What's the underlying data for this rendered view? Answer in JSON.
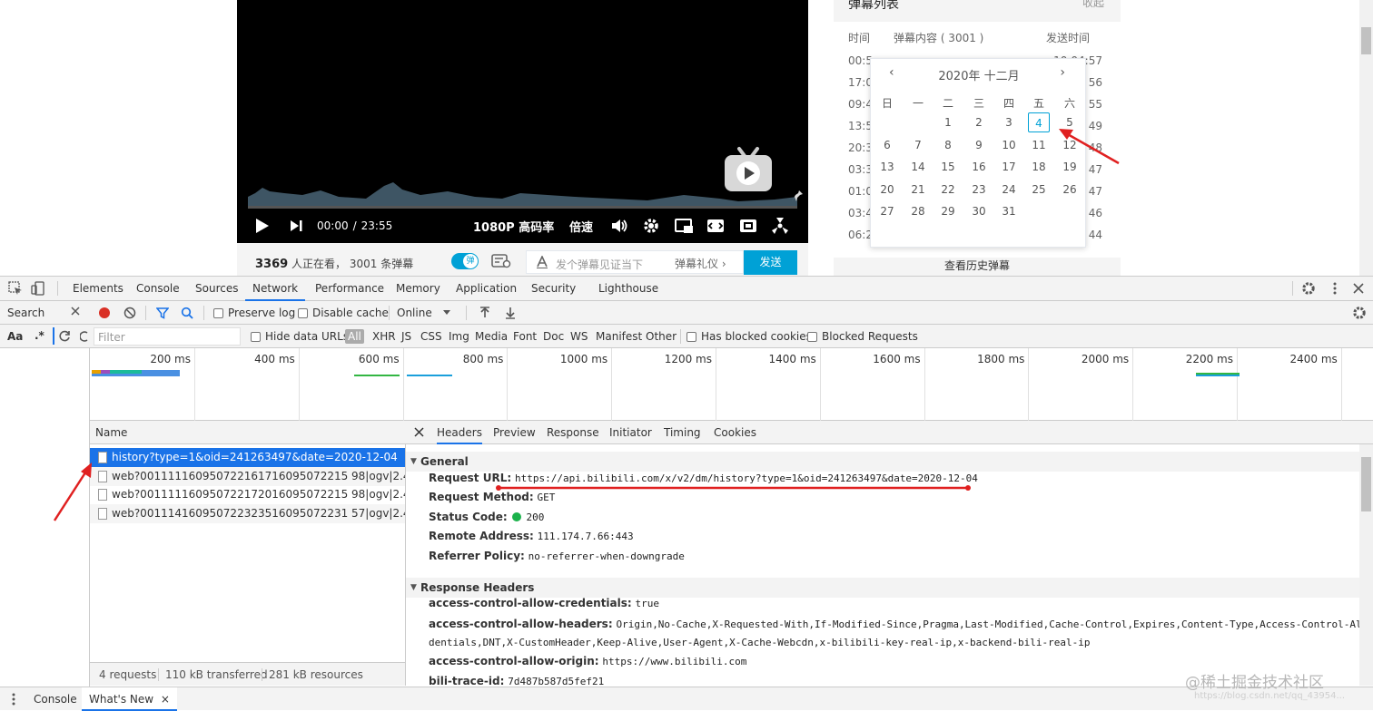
{
  "player": {
    "current_time": "00:00",
    "time_sep": "/",
    "duration": "23:55",
    "quality": "1080P 高码率",
    "speed": "倍速",
    "viewers_count": "3369",
    "viewers_text": "人正在看，",
    "danmaku_count_text": "3001 条弹幕",
    "danmaku_toggle": "弹",
    "danmaku_placeholder": "发个弹幕见证当下",
    "danmaku_etiquette": "弹幕礼仪 ›",
    "send_label": "发送"
  },
  "danmaku_panel": {
    "title": "弹幕列表",
    "collapse": "收起",
    "col_time": "时间",
    "col_content": "弹幕内容 ( 3001 )",
    "col_send_time": "发送时间",
    "row_times": [
      "00:5",
      "17:0",
      "09:4",
      "13:5",
      "20:3",
      "03:3",
      "01:0",
      "03:4",
      "06:2"
    ],
    "row_send_times": [
      "10:04:57",
      "56",
      "55",
      "49",
      "48",
      "47",
      "47",
      "46",
      "44"
    ],
    "history_button": "查看历史弹幕"
  },
  "calendar": {
    "header": "2020年 十二月",
    "prev": "‹",
    "next": "›",
    "weekdays": [
      "日",
      "一",
      "二",
      "三",
      "四",
      "五",
      "六"
    ],
    "weeks": [
      [
        "",
        "",
        "1",
        "2",
        "3",
        "4",
        "5"
      ],
      [
        "6",
        "7",
        "8",
        "9",
        "10",
        "11",
        "12"
      ],
      [
        "13",
        "14",
        "15",
        "16",
        "17",
        "18",
        "19"
      ],
      [
        "20",
        "21",
        "22",
        "23",
        "24",
        "25",
        "26"
      ],
      [
        "27",
        "28",
        "29",
        "30",
        "31",
        "",
        ""
      ]
    ],
    "selected": "4"
  },
  "devtools": {
    "tabs": [
      "Elements",
      "Console",
      "Sources",
      "Network",
      "Performance",
      "Memory",
      "Application",
      "Security",
      "Lighthouse"
    ],
    "active_tab": "Network",
    "search_label": "Search",
    "aa": "Aa",
    "regex": ".*",
    "toolbar": {
      "preserve_log": "Preserve log",
      "disable_cache": "Disable cache",
      "throttle": "Online"
    },
    "filter": {
      "placeholder": "Filter",
      "hide_data_urls": "Hide data URLs",
      "types": [
        "All",
        "XHR",
        "JS",
        "CSS",
        "Img",
        "Media",
        "Font",
        "Doc",
        "WS",
        "Manifest",
        "Other"
      ],
      "has_blocked_cookies": "Has blocked cookies",
      "blocked_requests": "Blocked Requests"
    },
    "timeline_ticks": [
      "200 ms",
      "400 ms",
      "600 ms",
      "800 ms",
      "1000 ms",
      "1200 ms",
      "1400 ms",
      "1600 ms",
      "1800 ms",
      "2000 ms",
      "2200 ms",
      "2400 ms"
    ],
    "list_header": "Name",
    "requests": [
      "history?type=1&oid=241263497&date=2020-12-04",
      "web?001111160950722161716095072215 98|ogv|2.48.8-82...",
      "web?001111160950722172016095072215 98|ogv|2.48.8-82...",
      "web?001114160950722323516095072231 57|ogv|2.48.8-82..."
    ],
    "status": {
      "requests": "4 requests",
      "transferred": "110 kB transferred",
      "resources": "281 kB resources"
    },
    "detail_tabs": [
      "Headers",
      "Preview",
      "Response",
      "Initiator",
      "Timing",
      "Cookies"
    ],
    "general_title": "General",
    "general": [
      {
        "k": "Request URL:",
        "v": "https://api.bilibili.com/x/v2/dm/history?type=1&oid=241263497&date=2020-12-04"
      },
      {
        "k": "Request Method:",
        "v": "GET"
      },
      {
        "k": "Status Code:",
        "v": "200"
      },
      {
        "k": "Remote Address:",
        "v": "111.174.7.66:443"
      },
      {
        "k": "Referrer Policy:",
        "v": "no-referrer-when-downgrade"
      }
    ],
    "response_title": "Response Headers",
    "response_headers": [
      {
        "k": "access-control-allow-credentials:",
        "v": "true"
      },
      {
        "k": "access-control-allow-headers:",
        "v": "Origin,No-Cache,X-Requested-With,If-Modified-Since,Pragma,Last-Modified,Cache-Control,Expires,Content-Type,Access-Control-Allow-Cre"
      },
      {
        "k": "",
        "v": "dentials,DNT,X-CustomHeader,Keep-Alive,User-Agent,X-Cache-Webcdn,x-bilibili-key-real-ip,x-backend-bili-real-ip"
      },
      {
        "k": "access-control-allow-origin:",
        "v": "https://www.bilibili.com"
      },
      {
        "k": "bili-trace-id:",
        "v": "7d487b587d5fef21"
      }
    ],
    "drawer": [
      "Console",
      "What's New"
    ],
    "drawer_close": "×"
  },
  "watermark": "@稀土掘金技术社区",
  "watermark_url": "https://blog.csdn.net/qq_43954..."
}
